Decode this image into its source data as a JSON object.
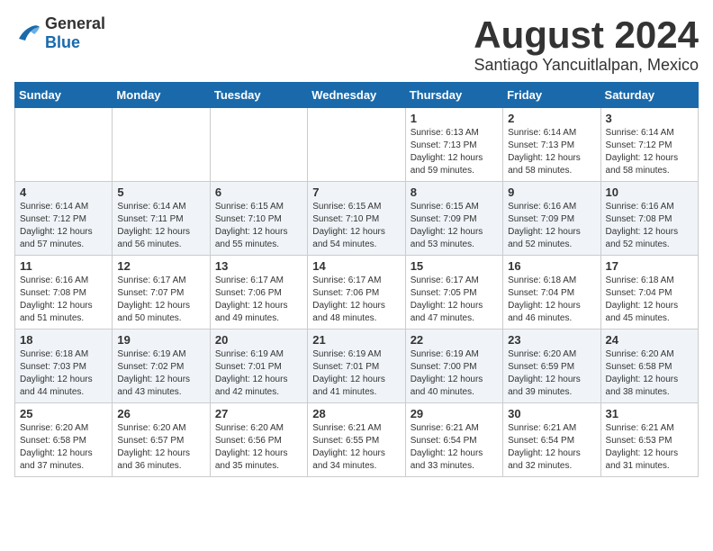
{
  "header": {
    "logo_general": "General",
    "logo_blue": "Blue",
    "main_title": "August 2024",
    "sub_title": "Santiago Yancuitlalpan, Mexico"
  },
  "weekdays": [
    "Sunday",
    "Monday",
    "Tuesday",
    "Wednesday",
    "Thursday",
    "Friday",
    "Saturday"
  ],
  "weeks": [
    [
      {
        "day": "",
        "info": ""
      },
      {
        "day": "",
        "info": ""
      },
      {
        "day": "",
        "info": ""
      },
      {
        "day": "",
        "info": ""
      },
      {
        "day": "1",
        "info": "Sunrise: 6:13 AM\nSunset: 7:13 PM\nDaylight: 12 hours\nand 59 minutes."
      },
      {
        "day": "2",
        "info": "Sunrise: 6:14 AM\nSunset: 7:13 PM\nDaylight: 12 hours\nand 58 minutes."
      },
      {
        "day": "3",
        "info": "Sunrise: 6:14 AM\nSunset: 7:12 PM\nDaylight: 12 hours\nand 58 minutes."
      }
    ],
    [
      {
        "day": "4",
        "info": "Sunrise: 6:14 AM\nSunset: 7:12 PM\nDaylight: 12 hours\nand 57 minutes."
      },
      {
        "day": "5",
        "info": "Sunrise: 6:14 AM\nSunset: 7:11 PM\nDaylight: 12 hours\nand 56 minutes."
      },
      {
        "day": "6",
        "info": "Sunrise: 6:15 AM\nSunset: 7:10 PM\nDaylight: 12 hours\nand 55 minutes."
      },
      {
        "day": "7",
        "info": "Sunrise: 6:15 AM\nSunset: 7:10 PM\nDaylight: 12 hours\nand 54 minutes."
      },
      {
        "day": "8",
        "info": "Sunrise: 6:15 AM\nSunset: 7:09 PM\nDaylight: 12 hours\nand 53 minutes."
      },
      {
        "day": "9",
        "info": "Sunrise: 6:16 AM\nSunset: 7:09 PM\nDaylight: 12 hours\nand 52 minutes."
      },
      {
        "day": "10",
        "info": "Sunrise: 6:16 AM\nSunset: 7:08 PM\nDaylight: 12 hours\nand 52 minutes."
      }
    ],
    [
      {
        "day": "11",
        "info": "Sunrise: 6:16 AM\nSunset: 7:08 PM\nDaylight: 12 hours\nand 51 minutes."
      },
      {
        "day": "12",
        "info": "Sunrise: 6:17 AM\nSunset: 7:07 PM\nDaylight: 12 hours\nand 50 minutes."
      },
      {
        "day": "13",
        "info": "Sunrise: 6:17 AM\nSunset: 7:06 PM\nDaylight: 12 hours\nand 49 minutes."
      },
      {
        "day": "14",
        "info": "Sunrise: 6:17 AM\nSunset: 7:06 PM\nDaylight: 12 hours\nand 48 minutes."
      },
      {
        "day": "15",
        "info": "Sunrise: 6:17 AM\nSunset: 7:05 PM\nDaylight: 12 hours\nand 47 minutes."
      },
      {
        "day": "16",
        "info": "Sunrise: 6:18 AM\nSunset: 7:04 PM\nDaylight: 12 hours\nand 46 minutes."
      },
      {
        "day": "17",
        "info": "Sunrise: 6:18 AM\nSunset: 7:04 PM\nDaylight: 12 hours\nand 45 minutes."
      }
    ],
    [
      {
        "day": "18",
        "info": "Sunrise: 6:18 AM\nSunset: 7:03 PM\nDaylight: 12 hours\nand 44 minutes."
      },
      {
        "day": "19",
        "info": "Sunrise: 6:19 AM\nSunset: 7:02 PM\nDaylight: 12 hours\nand 43 minutes."
      },
      {
        "day": "20",
        "info": "Sunrise: 6:19 AM\nSunset: 7:01 PM\nDaylight: 12 hours\nand 42 minutes."
      },
      {
        "day": "21",
        "info": "Sunrise: 6:19 AM\nSunset: 7:01 PM\nDaylight: 12 hours\nand 41 minutes."
      },
      {
        "day": "22",
        "info": "Sunrise: 6:19 AM\nSunset: 7:00 PM\nDaylight: 12 hours\nand 40 minutes."
      },
      {
        "day": "23",
        "info": "Sunrise: 6:20 AM\nSunset: 6:59 PM\nDaylight: 12 hours\nand 39 minutes."
      },
      {
        "day": "24",
        "info": "Sunrise: 6:20 AM\nSunset: 6:58 PM\nDaylight: 12 hours\nand 38 minutes."
      }
    ],
    [
      {
        "day": "25",
        "info": "Sunrise: 6:20 AM\nSunset: 6:58 PM\nDaylight: 12 hours\nand 37 minutes."
      },
      {
        "day": "26",
        "info": "Sunrise: 6:20 AM\nSunset: 6:57 PM\nDaylight: 12 hours\nand 36 minutes."
      },
      {
        "day": "27",
        "info": "Sunrise: 6:20 AM\nSunset: 6:56 PM\nDaylight: 12 hours\nand 35 minutes."
      },
      {
        "day": "28",
        "info": "Sunrise: 6:21 AM\nSunset: 6:55 PM\nDaylight: 12 hours\nand 34 minutes."
      },
      {
        "day": "29",
        "info": "Sunrise: 6:21 AM\nSunset: 6:54 PM\nDaylight: 12 hours\nand 33 minutes."
      },
      {
        "day": "30",
        "info": "Sunrise: 6:21 AM\nSunset: 6:54 PM\nDaylight: 12 hours\nand 32 minutes."
      },
      {
        "day": "31",
        "info": "Sunrise: 6:21 AM\nSunset: 6:53 PM\nDaylight: 12 hours\nand 31 minutes."
      }
    ]
  ]
}
